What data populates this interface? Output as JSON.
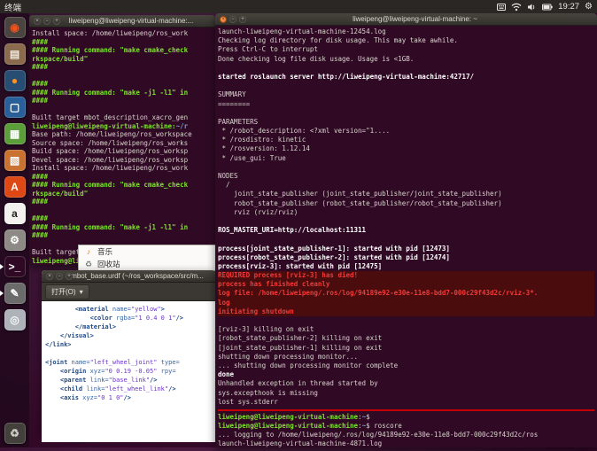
{
  "panel": {
    "app_title": "终端",
    "time": "19:27"
  },
  "launcher": {
    "items": [
      {
        "id": "dash",
        "bg": "#4A4440",
        "fg": "#E95420",
        "glyph": "◉"
      },
      {
        "id": "files",
        "bg": "#8A6B4D",
        "fg": "#F1E8DC",
        "glyph": "▤"
      },
      {
        "id": "firefox",
        "bg": "#274E72",
        "fg": "#FF9322",
        "glyph": "●"
      },
      {
        "id": "libreoffice-writer",
        "bg": "#2A6099",
        "fg": "#FFFFFF",
        "glyph": "▢"
      },
      {
        "id": "libreoffice-calc",
        "bg": "#5B9E3A",
        "fg": "#FFFFFF",
        "glyph": "▦"
      },
      {
        "id": "libreoffice-impress",
        "bg": "#C97231",
        "fg": "#FFFFFF",
        "glyph": "▧"
      },
      {
        "id": "ubuntu-software",
        "bg": "#DD4814",
        "fg": "#FFFFFF",
        "glyph": "A"
      },
      {
        "id": "amazon",
        "bg": "#F4F2EF",
        "fg": "#222222",
        "glyph": "a"
      },
      {
        "id": "system-settings",
        "bg": "#8D8A85",
        "fg": "#FFFFFF",
        "glyph": "⚙"
      },
      {
        "id": "terminal",
        "bg": "#300A24",
        "fg": "#FFFFFF",
        "glyph": ">_",
        "running": true
      },
      {
        "id": "text-editor",
        "bg": "#6B6B6B",
        "fg": "#FFFFFF",
        "glyph": "✎",
        "running": true
      },
      {
        "id": "dvd",
        "bg": "#AEB3BA",
        "fg": "#F4F6F8",
        "glyph": "◎"
      },
      {
        "id": "trash",
        "bg": "#44403C",
        "fg": "#CFCAC4",
        "glyph": "♻",
        "pin_bottom": true
      }
    ]
  },
  "left_terminal": {
    "title": "liweipeng@liweipeng-virtual-machine:...",
    "lines": [
      {
        "t": "Install space: /home/liweipeng/ros_work",
        "c": "w"
      },
      {
        "t": "####",
        "c": "g"
      },
      {
        "t": "#### Running command: \"make cmake_check",
        "c": "g"
      },
      {
        "t": "rkspace/build\"",
        "c": "g"
      },
      {
        "t": "####",
        "c": "g"
      },
      {
        "t": "",
        "c": "w"
      },
      {
        "t": "####",
        "c": "g"
      },
      {
        "t": "#### Running command: \"make -j1 -l1\" in",
        "c": "g"
      },
      {
        "t": "####",
        "c": "g"
      },
      {
        "t": "",
        "c": "w"
      },
      {
        "t": "Built target mbot_description_xacro_gen",
        "c": "w"
      },
      {
        "segs": [
          {
            "t": "liweipeng@liweipeng-virtual-machine:",
            "c": "g"
          },
          {
            "t": "~/r",
            "c": "b"
          }
        ]
      },
      {
        "t": "Base path: /home/liweipeng/ros_workspace",
        "c": "w"
      },
      {
        "t": "Source space: /home/liweipeng/ros_works",
        "c": "w"
      },
      {
        "t": "Build space: /home/liweipeng/ros_worksp",
        "c": "w"
      },
      {
        "t": "Devel space: /home/liweipeng/ros_worksp",
        "c": "w"
      },
      {
        "t": "Install space: /home/liweipeng/ros_work",
        "c": "w"
      },
      {
        "t": "####",
        "c": "g"
      },
      {
        "t": "#### Running command: \"make cmake_check",
        "c": "g"
      },
      {
        "t": "rkspace/build\"",
        "c": "g"
      },
      {
        "t": "####",
        "c": "g"
      },
      {
        "t": "",
        "c": "w"
      },
      {
        "t": "####",
        "c": "g"
      },
      {
        "t": "#### Running command: \"make -j1 -l1\" in",
        "c": "g"
      },
      {
        "t": "####",
        "c": "g"
      },
      {
        "t": "",
        "c": "w"
      },
      {
        "t": "Built target mbot_description_xacro_gen",
        "c": "w"
      },
      {
        "segs": [
          {
            "t": "liweipeng@liweipeng-virtual-machine:",
            "c": "g"
          },
          {
            "t": "~/r",
            "c": "b"
          }
        ]
      }
    ]
  },
  "right_terminal": {
    "title": "liweipeng@liweipeng-virtual-machine: ~",
    "lines": [
      {
        "t": "launch-liweipeng-virtual-machine-12454.log",
        "c": "w"
      },
      {
        "t": "Checking log directory for disk usage. This may take awhile.",
        "c": "w"
      },
      {
        "t": "Press Ctrl-C to interrupt",
        "c": "w"
      },
      {
        "t": "Done checking log file disk usage. Usage is <1GB.",
        "c": "w"
      },
      {
        "t": "",
        "c": "w"
      },
      {
        "t": "started roslaunch server http://liweipeng-virtual-machine:42717/",
        "c": "bw"
      },
      {
        "t": "",
        "c": "w"
      },
      {
        "t": "SUMMARY",
        "c": "w"
      },
      {
        "t": "========",
        "c": "w"
      },
      {
        "t": "",
        "c": "w"
      },
      {
        "t": "PARAMETERS",
        "c": "w"
      },
      {
        "t": " * /robot_description: <?xml version=\"1....",
        "c": "w"
      },
      {
        "t": " * /rosdistro: kinetic",
        "c": "w"
      },
      {
        "t": " * /rosversion: 1.12.14",
        "c": "w"
      },
      {
        "t": " * /use_gui: True",
        "c": "w"
      },
      {
        "t": "",
        "c": "w"
      },
      {
        "t": "NODES",
        "c": "w"
      },
      {
        "t": "  /",
        "c": "w"
      },
      {
        "t": "    joint_state_publisher (joint_state_publisher/joint_state_publisher)",
        "c": "w"
      },
      {
        "t": "    robot_state_publisher (robot_state_publisher/robot_state_publisher)",
        "c": "w"
      },
      {
        "t": "    rviz (rviz/rviz)",
        "c": "w"
      },
      {
        "t": "",
        "c": "w"
      },
      {
        "t": "ROS_MASTER_URI=http://localhost:11311",
        "c": "bw"
      },
      {
        "t": "",
        "c": "w"
      },
      {
        "t": "process[joint_state_publisher-1]: started with pid [12473]",
        "c": "bw"
      },
      {
        "t": "process[robot_state_publisher-2]: started with pid [12474]",
        "c": "bw"
      },
      {
        "t": "process[rviz-3]: started with pid [12475]",
        "c": "bw"
      },
      {
        "t": "REQUIRED process [rviz-3] has died!",
        "c": "r",
        "hl": true
      },
      {
        "t": "process has finished cleanly",
        "c": "r",
        "hl": true
      },
      {
        "t": "log file: /home/liweipeng/.ros/log/94189e92-e30e-11e8-bdd7-000c29f43d2c/rviz-3*.",
        "c": "r",
        "hl": true
      },
      {
        "t": "log",
        "c": "r",
        "hl": true
      },
      {
        "t": "initiating shutdown",
        "c": "r",
        "hl": true
      },
      {
        "t": "",
        "c": "w"
      },
      {
        "t": "[rviz-3] killing on exit",
        "c": "w"
      },
      {
        "t": "[robot_state_publisher-2] killing on exit",
        "c": "w"
      },
      {
        "t": "[joint_state_publisher-1] killing on exit",
        "c": "w"
      },
      {
        "t": "shutting down processing monitor...",
        "c": "w"
      },
      {
        "t": "... shutting down processing monitor complete",
        "c": "w"
      },
      {
        "t": "done",
        "c": "bw"
      },
      {
        "t": "Unhandled exception in thread started by",
        "c": "w"
      },
      {
        "t": "sys.excepthook is missing",
        "c": "w"
      },
      {
        "t": "lost sys.stderr",
        "c": "w"
      },
      {
        "divider": true
      },
      {
        "segs": [
          {
            "t": "liweipeng@liweipeng-virtual-machine",
            "c": "g"
          },
          {
            "t": ":",
            "c": "w"
          },
          {
            "t": "~",
            "c": "b"
          },
          {
            "t": "$",
            "c": "w"
          }
        ]
      },
      {
        "segs": [
          {
            "t": "liweipeng@liweipeng-virtual-machine",
            "c": "g"
          },
          {
            "t": ":",
            "c": "w"
          },
          {
            "t": "~",
            "c": "b"
          },
          {
            "t": "$ roscore",
            "c": "w"
          }
        ]
      },
      {
        "t": "... logging to /home/liweipeng/.ros/log/94189e92-e30e-11e8-bdd7-000c29f43d2c/ros",
        "c": "w"
      },
      {
        "t": "launch-liweipeng-virtual-machine-4871.log",
        "c": "w"
      }
    ]
  },
  "gedit": {
    "title": "mbot_base.urdf (~/ros_workspace/src/m...",
    "open_button": "打开(O)",
    "open_caret": "▾",
    "lines": [
      {
        "segs": [
          {
            "t": "        ",
            "c": "p"
          },
          {
            "t": "<material",
            "c": "tag"
          },
          {
            "t": " name=",
            "c": "attr"
          },
          {
            "t": "\"yellow\"",
            "c": "val"
          },
          {
            "t": ">",
            "c": "tag"
          }
        ]
      },
      {
        "segs": [
          {
            "t": "            ",
            "c": "p"
          },
          {
            "t": "<color",
            "c": "tag"
          },
          {
            "t": " rgba=",
            "c": "attr"
          },
          {
            "t": "\"1 0.4 0 1\"",
            "c": "val"
          },
          {
            "t": "/>",
            "c": "tag"
          }
        ]
      },
      {
        "segs": [
          {
            "t": "        ",
            "c": "p"
          },
          {
            "t": "</material>",
            "c": "tag"
          }
        ]
      },
      {
        "segs": [
          {
            "t": "    ",
            "c": "p"
          },
          {
            "t": "</visual>",
            "c": "tag"
          }
        ]
      },
      {
        "segs": [
          {
            "t": "</link>",
            "c": "tag"
          }
        ]
      },
      {
        "segs": [
          {
            "t": "",
            "c": "p"
          }
        ]
      },
      {
        "segs": [
          {
            "t": "<joint",
            "c": "tag"
          },
          {
            "t": " name=",
            "c": "attr"
          },
          {
            "t": "\"left_wheel_joint\"",
            "c": "val"
          },
          {
            "t": " type=",
            "c": "attr"
          }
        ]
      },
      {
        "segs": [
          {
            "t": "    ",
            "c": "p"
          },
          {
            "t": "<origin",
            "c": "tag"
          },
          {
            "t": " xyz=",
            "c": "attr"
          },
          {
            "t": "\"0 0.19 -0.05\"",
            "c": "val"
          },
          {
            "t": " rpy=",
            "c": "attr"
          }
        ]
      },
      {
        "segs": [
          {
            "t": "    ",
            "c": "p"
          },
          {
            "t": "<parent",
            "c": "tag"
          },
          {
            "t": " link=",
            "c": "attr"
          },
          {
            "t": "\"base_link\"",
            "c": "val"
          },
          {
            "t": "/>",
            "c": "tag"
          }
        ]
      },
      {
        "segs": [
          {
            "t": "    ",
            "c": "p"
          },
          {
            "t": "<child",
            "c": "tag"
          },
          {
            "t": " link=",
            "c": "attr"
          },
          {
            "t": "\"left_wheel_link\"",
            "c": "val"
          },
          {
            "t": "/>",
            "c": "tag"
          }
        ]
      },
      {
        "segs": [
          {
            "t": "    ",
            "c": "p"
          },
          {
            "t": "<axis",
            "c": "tag"
          },
          {
            "t": " xyz=",
            "c": "attr"
          },
          {
            "t": "\"0 1 0\"",
            "c": "val"
          },
          {
            "t": "/>",
            "c": "tag"
          }
        ]
      }
    ]
  },
  "places_dropdown": {
    "items": [
      {
        "name": "music",
        "glyph": "♪",
        "glyph_color": "#D9822B",
        "label": "音乐"
      },
      {
        "name": "trash",
        "glyph": "♻",
        "glyph_color": "#6E7B7B",
        "label": "回收站"
      }
    ]
  }
}
